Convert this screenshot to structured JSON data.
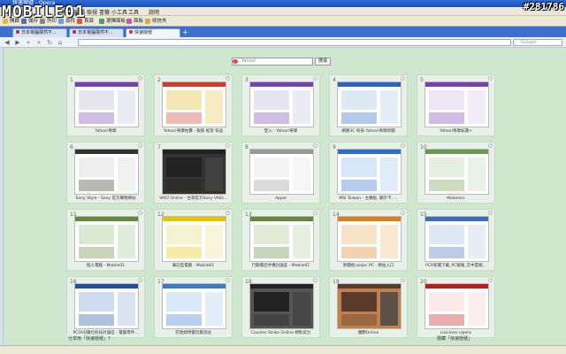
{
  "watermark": {
    "brand": "MOBILE01",
    "id": "#281786"
  },
  "window": {
    "title": "快速撥號 - Opera"
  },
  "menu": {
    "items": [
      "檔案",
      "編輯",
      "檢視",
      "書籤",
      "小工具",
      "工具",
      "說明"
    ]
  },
  "toolbar": {
    "items": [
      "開啟",
      "儲存",
      "列印",
      "尋找",
      "首頁",
      "選擇面板",
      "面板",
      "收信夾"
    ]
  },
  "tabs": [
    {
      "label": "日本電腦展然不..."
    },
    {
      "label": "日本電腦展然不..."
    },
    {
      "label": "快速撥號"
    }
  ],
  "search": {
    "placeholder": "Yahoo!",
    "button": "搜尋",
    "nav_placeholder": "Google"
  },
  "speed_dial": [
    {
      "num": "1",
      "label": "Yahoo!奇摩",
      "colors": [
        "#7a3fb5",
        "#e6e6f0"
      ]
    },
    {
      "num": "2",
      "label": "Yahoo!奇摩拍賣 - 服裝 框架 傢品",
      "colors": [
        "#d23a2a",
        "#f4e7b5"
      ]
    },
    {
      "num": "3",
      "label": "登入 - Yahoo!奇摩",
      "colors": [
        "#7a3fb5",
        "#e6e6f0"
      ]
    },
    {
      "num": "4",
      "label": "網路3C-科技-Yahoo!奇摩新聞",
      "colors": [
        "#2a64c2",
        "#dfe9f6"
      ]
    },
    {
      "num": "5",
      "label": "Yahoo!奇摩知識+",
      "colors": [
        "#7a3fb5",
        "#efe6f6"
      ]
    },
    {
      "num": "6",
      "label": "Sony Style - Sony 官方購物網站",
      "colors": [
        "#333333",
        "#eeeeee"
      ]
    },
    {
      "num": "7",
      "label": "VAIO Online - 台灣官方Sony VAIO...",
      "colors": [
        "#222222",
        "#333333"
      ]
    },
    {
      "num": "8",
      "label": "Apple",
      "colors": [
        "#999999",
        "#f4f4f4"
      ]
    },
    {
      "num": "9",
      "label": "MSI Taiwan - 主機板, 顯示卡, ...",
      "colors": [
        "#2a70c8",
        "#d7e6f8"
      ]
    },
    {
      "num": "10",
      "label": "Mobile01",
      "colors": [
        "#6a9a4a",
        "#e4efe0"
      ]
    },
    {
      "num": "11",
      "label": "個人電腦 - Mobile01",
      "colors": [
        "#5e8a3a",
        "#d9e9d2"
      ]
    },
    {
      "num": "12",
      "label": "筆記型電腦 - Mobile01",
      "colors": [
        "#e5c400",
        "#f6f3d2"
      ]
    },
    {
      "num": "13",
      "label": "行動電話手機討論區 - Mobile01",
      "colors": [
        "#5e8a3a",
        "#e0ecd8"
      ]
    },
    {
      "num": "14",
      "label": "原價屋coolpc PC - 網站入口",
      "colors": [
        "#d9801c",
        "#f7e3c7"
      ]
    },
    {
      "num": "15",
      "label": "PCR新聞下載_PC報報_交中雲端...",
      "colors": [
        "#3a6cb8",
        "#dfe8f5"
      ]
    },
    {
      "num": "16",
      "label": "PCDVD數位科技討論區 - 電腦零件...",
      "colors": [
        "#1e4fa0",
        "#d2dcf0"
      ]
    },
    {
      "num": "17",
      "label": "巴哈姆特電玩資訊站",
      "colors": [
        "#3a7ac8",
        "#dbe9f8"
      ]
    },
    {
      "num": "18",
      "label": "Counter Strike Online 絕對武力",
      "colors": [
        "#222222",
        "#555555"
      ]
    },
    {
      "num": "19",
      "label": "魔獸Online",
      "colors": [
        "#5a3a2a",
        "#c08050"
      ]
    },
    {
      "num": "20",
      "label": "Discover Opera",
      "colors": [
        "#c01a1a",
        "#fbeaea"
      ]
    }
  ],
  "footer": {
    "left": "分享用「快速撥號」?",
    "right": "隱藏「快速撥號」"
  }
}
